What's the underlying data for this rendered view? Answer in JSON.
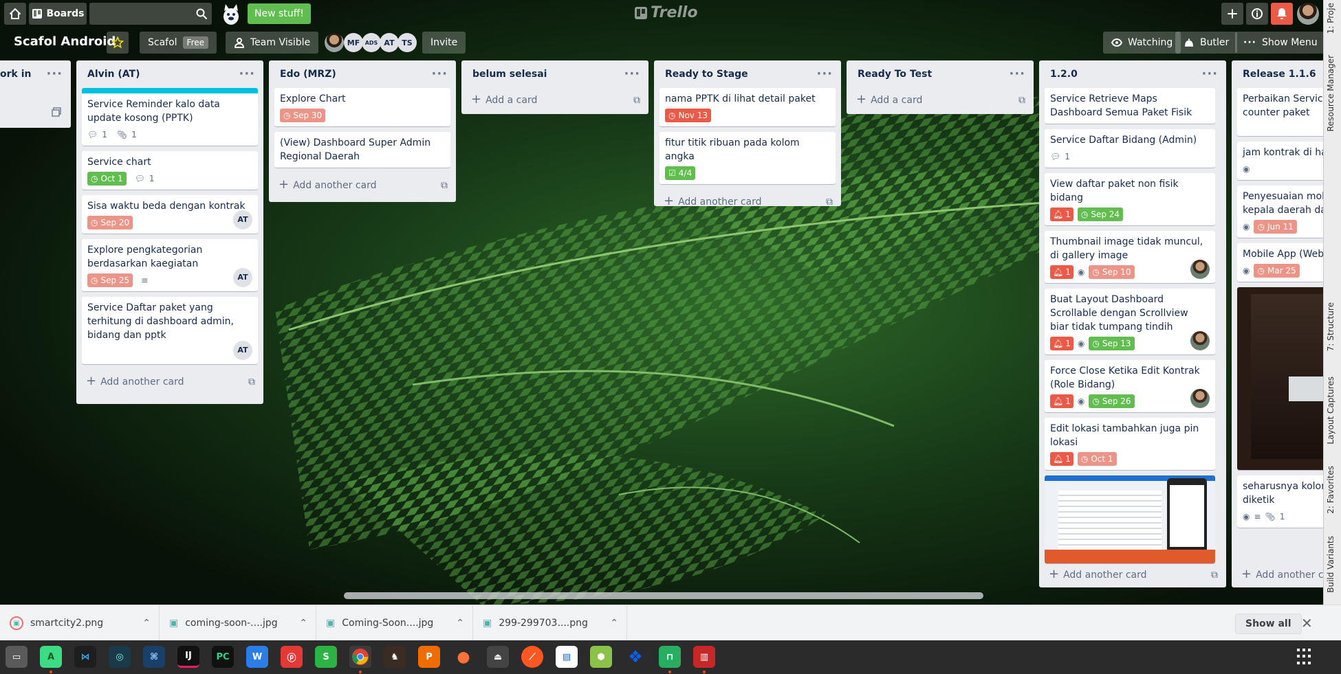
{
  "header": {
    "home_label": "",
    "boards_label": "Boards",
    "search_placeholder": "",
    "new_stuff": "New stuff!",
    "logo": "Trello"
  },
  "board": {
    "title": "Scafol Android",
    "team_name": "Scafol",
    "team_badge": "Free",
    "visibility": "Team Visible",
    "members": [
      "MF",
      "ADS",
      "AT",
      "TS"
    ],
    "invite": "Invite",
    "watching": "Watching",
    "butler": "Butler",
    "show_menu": "Show Menu"
  },
  "lists": [
    {
      "title": "ork in",
      "cards": []
    },
    {
      "title": "Alvin (AT)",
      "cards": [
        {
          "title": "Service Reminder kalo data update kosong (PPTK)",
          "comments": "1",
          "attachments": "1"
        },
        {
          "title": "Service chart",
          "due": "Oct 1",
          "comments": "1"
        },
        {
          "title": "Sisa waktu beda dengan kontrak",
          "due": "Sep 20",
          "member": "AT"
        },
        {
          "title": "Explore pengkategorian berdasarkan kaegiatan",
          "due": "Sep 25",
          "member": "AT"
        },
        {
          "title": "Service Daftar paket yang terhitung di dashboard admin, bidang dan pptk",
          "member": "AT"
        }
      ],
      "add": "Add another card"
    },
    {
      "title": "Edo (MRZ)",
      "cards": [
        {
          "title": "Explore Chart",
          "due": "Sep 30"
        },
        {
          "title": "(View) Dashboard Super Admin Regional Daerah"
        }
      ],
      "add": "Add another card"
    },
    {
      "title": "belum selesai",
      "cards": [],
      "add": "Add a card"
    },
    {
      "title": "Ready to Stage",
      "cards": [
        {
          "title": "nama PPTK di lihat detail paket",
          "due": "Nov 13"
        },
        {
          "title": "fitur titik ribuan pada kolom angka",
          "checklist": "4/4"
        }
      ],
      "add": "Add another card"
    },
    {
      "title": "Ready To Test",
      "cards": [],
      "add": "Add a card"
    },
    {
      "title": "1.2.0",
      "cards": [
        {
          "title": "Service Retrieve Maps Dashboard Semua Paket Fisik"
        },
        {
          "title": "Service Daftar Bidang (Admin)",
          "comments": "1"
        },
        {
          "title": "View daftar paket non fisik bidang",
          "notif": "1",
          "due": "Sep 24"
        },
        {
          "title": "Thumbnail image tidak muncul, di gallery image",
          "notif": "1",
          "due": "Sep 10"
        },
        {
          "title": "Buat Layout Dashboard Scrollable dengan Scrollview biar tidak tumpang tindih",
          "notif": "1",
          "due": "Sep 13"
        },
        {
          "title": "Force Close Ketika Edit Kontrak (Role Bidang)",
          "notif": "1",
          "due": "Sep 26"
        },
        {
          "title": "Edit lokasi tambahkan juga pin lokasi",
          "notif": "1",
          "due": "Oct 1"
        }
      ],
      "add": "Add another card"
    },
    {
      "title": "Release 1.1.6",
      "cards": [
        {
          "title": "Perbaikan Service counter paket"
        },
        {
          "title": "jam kontrak di hap"
        },
        {
          "title": "Penyesuaian mobi kepala daerah dari",
          "due": "Jun 11"
        },
        {
          "title": "Mobile App (Webv",
          "due": "Mar 25"
        },
        {
          "title": "seharusnya kolom diketik",
          "attachments": "1"
        }
      ],
      "add": "Add another ca"
    }
  ],
  "downloads": {
    "items": [
      "smartcity2.png",
      "coming-soon-....jpg",
      "Coming-Soon....jpg",
      "299-299703....png"
    ],
    "show_all": "Show all"
  },
  "ide_tabs": [
    "1: Proje",
    "Resource Manager",
    "7: Structure",
    "Layout Captures",
    "2: Favorites",
    "Build Variants"
  ],
  "colors": {
    "due_red": "#eb5a46",
    "due_green": "#61bd4f",
    "due_light": "#ec9488",
    "list_bg": "#ebecf0",
    "accent_cyan": "#00c2e0"
  }
}
